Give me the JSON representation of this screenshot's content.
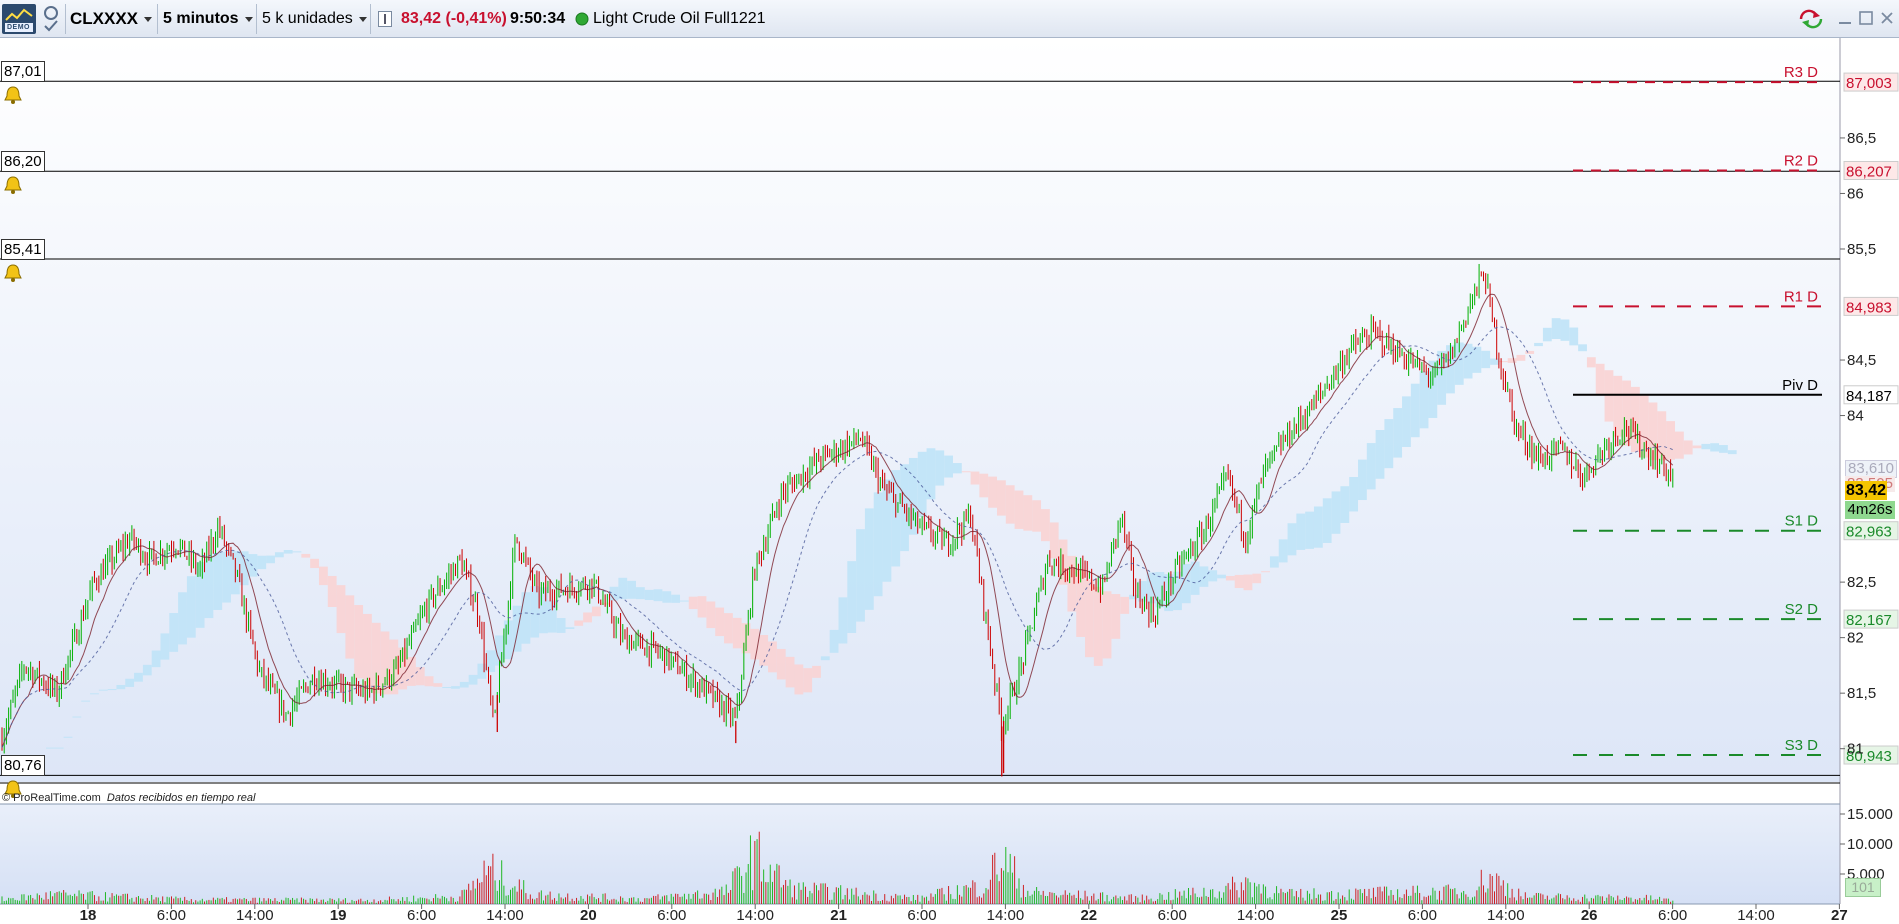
{
  "toolbar": {
    "demo_label": "DEMO",
    "ticker": "CLXXXX",
    "timeframe": "5 minutos",
    "units": "5 k unidades",
    "price_change": "83,42 (-0,41%)",
    "time": "9:50:34",
    "instrument": "Light Crude Oil Full1221"
  },
  "colors": {
    "resistance": "#c8102e",
    "support": "#1a8a2a",
    "pivot": "#000000",
    "bull_candle": "#00b000",
    "bear_candle": "#cc0000",
    "cloud_bull": "#bfe3f7",
    "cloud_bear": "#f9d3d3",
    "background_top": "#ffffff",
    "background_bottom": "#dde6f7"
  },
  "alert_levels": [
    {
      "label": "87,01",
      "value": 87.01
    },
    {
      "label": "86,20",
      "value": 86.2
    },
    {
      "label": "85,41",
      "value": 85.41
    },
    {
      "label": "80,76",
      "value": 80.76
    }
  ],
  "pivots": [
    {
      "name": "R3 D",
      "value": 87.003,
      "label": "87,003",
      "type": "resistance"
    },
    {
      "name": "R2 D",
      "value": 86.207,
      "label": "86,207",
      "type": "resistance"
    },
    {
      "name": "R1 D",
      "value": 84.983,
      "label": "84,983",
      "type": "resistance"
    },
    {
      "name": "Piv D",
      "value": 84.187,
      "label": "84,187",
      "type": "pivot"
    },
    {
      "name": "S1 D",
      "value": 82.963,
      "label": "82,963",
      "type": "support"
    },
    {
      "name": "S2 D",
      "value": 82.167,
      "label": "82,167",
      "type": "support"
    },
    {
      "name": "S3 D",
      "value": 80.943,
      "label": "80,943",
      "type": "support"
    }
  ],
  "right_axis": {
    "ticks": [
      {
        "label": "86,5",
        "value": 86.5
      },
      {
        "label": "86",
        "value": 86.0
      },
      {
        "label": "85,5",
        "value": 85.5
      },
      {
        "label": "84,5",
        "value": 84.5
      },
      {
        "label": "84",
        "value": 84.0
      },
      {
        "label": "82,5",
        "value": 82.5
      },
      {
        "label": "82",
        "value": 82.0
      },
      {
        "label": "81,5",
        "value": 81.5
      },
      {
        "label": "81",
        "value": 81.0
      }
    ],
    "cloud_top_label": "83,610",
    "cloud_bottom_label": "83,505",
    "last_price_label": "83,42",
    "countdown_label": "4m26s"
  },
  "volume_axis": {
    "ticks": [
      {
        "label": "15.000",
        "value": 15000
      },
      {
        "label": "10.000",
        "value": 10000
      },
      {
        "label": "5.000",
        "value": 5000
      }
    ],
    "last_volume_label": "101"
  },
  "footer": {
    "credit": "© ProRealTime.com",
    "status": "Datos recibidos en tiempo real"
  },
  "x_axis": {
    "ticks": [
      {
        "label": "18",
        "day": true
      },
      {
        "label": "6:00",
        "day": false
      },
      {
        "label": "14:00",
        "day": false
      },
      {
        "label": "19",
        "day": true
      },
      {
        "label": "6:00",
        "day": false
      },
      {
        "label": "14:00",
        "day": false
      },
      {
        "label": "20",
        "day": true
      },
      {
        "label": "6:00",
        "day": false
      },
      {
        "label": "14:00",
        "day": false
      },
      {
        "label": "21",
        "day": true
      },
      {
        "label": "6:00",
        "day": false
      },
      {
        "label": "14:00",
        "day": false
      },
      {
        "label": "22",
        "day": true
      },
      {
        "label": "6:00",
        "day": false
      },
      {
        "label": "14:00",
        "day": false
      },
      {
        "label": "25",
        "day": true
      },
      {
        "label": "6:00",
        "day": false
      },
      {
        "label": "14:00",
        "day": false
      },
      {
        "label": "26",
        "day": true
      },
      {
        "label": "6:00",
        "day": false
      },
      {
        "label": "14:00",
        "day": false
      },
      {
        "label": "27",
        "day": true
      }
    ]
  },
  "chart_data": {
    "type": "candlestick",
    "price_scale": {
      "min": 80.7,
      "max": 87.4
    },
    "volume_scale": {
      "min": 0,
      "max": 16000
    },
    "price_path": [
      [
        0,
        81.1
      ],
      [
        0.012,
        81.75
      ],
      [
        0.03,
        81.5
      ],
      [
        0.05,
        82.5
      ],
      [
        0.07,
        82.9
      ],
      [
        0.08,
        82.7
      ],
      [
        0.095,
        82.85
      ],
      [
        0.108,
        82.6
      ],
      [
        0.118,
        83.0
      ],
      [
        0.128,
        82.55
      ],
      [
        0.14,
        81.7
      ],
      [
        0.155,
        81.3
      ],
      [
        0.17,
        81.65
      ],
      [
        0.185,
        81.55
      ],
      [
        0.2,
        81.5
      ],
      [
        0.215,
        81.7
      ],
      [
        0.232,
        82.3
      ],
      [
        0.25,
        82.7
      ],
      [
        0.26,
        82.2
      ],
      [
        0.268,
        81.2
      ],
      [
        0.28,
        82.9
      ],
      [
        0.292,
        82.4
      ],
      [
        0.31,
        82.45
      ],
      [
        0.322,
        82.5
      ],
      [
        0.338,
        82.0
      ],
      [
        0.36,
        81.85
      ],
      [
        0.385,
        81.5
      ],
      [
        0.4,
        81.25
      ],
      [
        0.41,
        82.6
      ],
      [
        0.425,
        83.3
      ],
      [
        0.445,
        83.6
      ],
      [
        0.468,
        83.8
      ],
      [
        0.48,
        83.35
      ],
      [
        0.5,
        83.0
      ],
      [
        0.515,
        82.85
      ],
      [
        0.528,
        83.1
      ],
      [
        0.537,
        82.1
      ],
      [
        0.545,
        81.2
      ],
      [
        0.555,
        81.7
      ],
      [
        0.57,
        82.7
      ],
      [
        0.585,
        82.6
      ],
      [
        0.6,
        82.45
      ],
      [
        0.61,
        83.1
      ],
      [
        0.618,
        82.4
      ],
      [
        0.628,
        82.2
      ],
      [
        0.64,
        82.6
      ],
      [
        0.655,
        82.95
      ],
      [
        0.668,
        83.45
      ],
      [
        0.678,
        82.9
      ],
      [
        0.688,
        83.5
      ],
      [
        0.7,
        83.8
      ],
      [
        0.715,
        84.1
      ],
      [
        0.735,
        84.6
      ],
      [
        0.748,
        84.75
      ],
      [
        0.762,
        84.55
      ],
      [
        0.78,
        84.35
      ],
      [
        0.79,
        84.55
      ],
      [
        0.8,
        85.0
      ],
      [
        0.808,
        85.3
      ],
      [
        0.815,
        84.6
      ],
      [
        0.825,
        83.9
      ],
      [
        0.838,
        83.6
      ],
      [
        0.85,
        83.7
      ],
      [
        0.862,
        83.45
      ],
      [
        0.875,
        83.75
      ],
      [
        0.885,
        83.9
      ],
      [
        0.895,
        83.7
      ],
      [
        0.905,
        83.55
      ],
      [
        0.912,
        83.42
      ]
    ],
    "volume_path": [
      [
        0,
        800
      ],
      [
        0.03,
        1500
      ],
      [
        0.1,
        700
      ],
      [
        0.2,
        600
      ],
      [
        0.25,
        1200
      ],
      [
        0.265,
        5500
      ],
      [
        0.29,
        1500
      ],
      [
        0.35,
        800
      ],
      [
        0.395,
        2000
      ],
      [
        0.41,
        8000
      ],
      [
        0.43,
        2500
      ],
      [
        0.5,
        900
      ],
      [
        0.535,
        3000
      ],
      [
        0.545,
        7500
      ],
      [
        0.56,
        1800
      ],
      [
        0.62,
        900
      ],
      [
        0.665,
        2200
      ],
      [
        0.68,
        3500
      ],
      [
        0.7,
        1500
      ],
      [
        0.8,
        2000
      ],
      [
        0.81,
        4500
      ],
      [
        0.83,
        1200
      ],
      [
        0.9,
        900
      ],
      [
        0.912,
        500
      ]
    ],
    "spikes": [
      [
        0.4,
        81.05
      ],
      [
        0.545,
        80.75
      ],
      [
        0.546,
        80.78
      ],
      [
        0.27,
        81.15
      ]
    ]
  }
}
